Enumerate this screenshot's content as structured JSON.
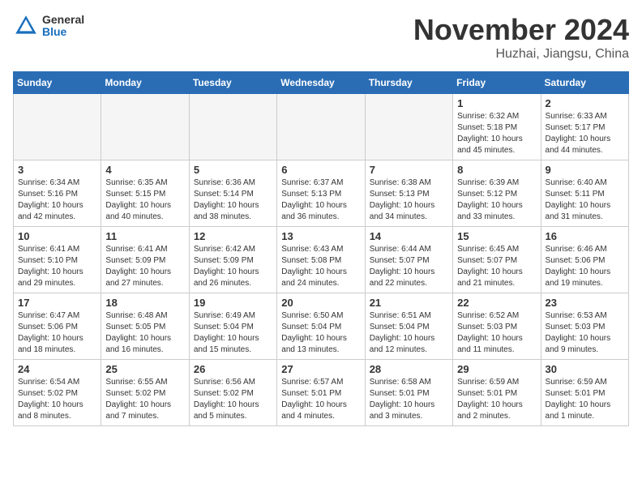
{
  "logo": {
    "general": "General",
    "blue": "Blue"
  },
  "title": "November 2024",
  "location": "Huzhai, Jiangsu, China",
  "weekdays": [
    "Sunday",
    "Monday",
    "Tuesday",
    "Wednesday",
    "Thursday",
    "Friday",
    "Saturday"
  ],
  "weeks": [
    [
      {
        "day": "",
        "info": ""
      },
      {
        "day": "",
        "info": ""
      },
      {
        "day": "",
        "info": ""
      },
      {
        "day": "",
        "info": ""
      },
      {
        "day": "",
        "info": ""
      },
      {
        "day": "1",
        "info": "Sunrise: 6:32 AM\nSunset: 5:18 PM\nDaylight: 10 hours\nand 45 minutes."
      },
      {
        "day": "2",
        "info": "Sunrise: 6:33 AM\nSunset: 5:17 PM\nDaylight: 10 hours\nand 44 minutes."
      }
    ],
    [
      {
        "day": "3",
        "info": "Sunrise: 6:34 AM\nSunset: 5:16 PM\nDaylight: 10 hours\nand 42 minutes."
      },
      {
        "day": "4",
        "info": "Sunrise: 6:35 AM\nSunset: 5:15 PM\nDaylight: 10 hours\nand 40 minutes."
      },
      {
        "day": "5",
        "info": "Sunrise: 6:36 AM\nSunset: 5:14 PM\nDaylight: 10 hours\nand 38 minutes."
      },
      {
        "day": "6",
        "info": "Sunrise: 6:37 AM\nSunset: 5:13 PM\nDaylight: 10 hours\nand 36 minutes."
      },
      {
        "day": "7",
        "info": "Sunrise: 6:38 AM\nSunset: 5:13 PM\nDaylight: 10 hours\nand 34 minutes."
      },
      {
        "day": "8",
        "info": "Sunrise: 6:39 AM\nSunset: 5:12 PM\nDaylight: 10 hours\nand 33 minutes."
      },
      {
        "day": "9",
        "info": "Sunrise: 6:40 AM\nSunset: 5:11 PM\nDaylight: 10 hours\nand 31 minutes."
      }
    ],
    [
      {
        "day": "10",
        "info": "Sunrise: 6:41 AM\nSunset: 5:10 PM\nDaylight: 10 hours\nand 29 minutes."
      },
      {
        "day": "11",
        "info": "Sunrise: 6:41 AM\nSunset: 5:09 PM\nDaylight: 10 hours\nand 27 minutes."
      },
      {
        "day": "12",
        "info": "Sunrise: 6:42 AM\nSunset: 5:09 PM\nDaylight: 10 hours\nand 26 minutes."
      },
      {
        "day": "13",
        "info": "Sunrise: 6:43 AM\nSunset: 5:08 PM\nDaylight: 10 hours\nand 24 minutes."
      },
      {
        "day": "14",
        "info": "Sunrise: 6:44 AM\nSunset: 5:07 PM\nDaylight: 10 hours\nand 22 minutes."
      },
      {
        "day": "15",
        "info": "Sunrise: 6:45 AM\nSunset: 5:07 PM\nDaylight: 10 hours\nand 21 minutes."
      },
      {
        "day": "16",
        "info": "Sunrise: 6:46 AM\nSunset: 5:06 PM\nDaylight: 10 hours\nand 19 minutes."
      }
    ],
    [
      {
        "day": "17",
        "info": "Sunrise: 6:47 AM\nSunset: 5:06 PM\nDaylight: 10 hours\nand 18 minutes."
      },
      {
        "day": "18",
        "info": "Sunrise: 6:48 AM\nSunset: 5:05 PM\nDaylight: 10 hours\nand 16 minutes."
      },
      {
        "day": "19",
        "info": "Sunrise: 6:49 AM\nSunset: 5:04 PM\nDaylight: 10 hours\nand 15 minutes."
      },
      {
        "day": "20",
        "info": "Sunrise: 6:50 AM\nSunset: 5:04 PM\nDaylight: 10 hours\nand 13 minutes."
      },
      {
        "day": "21",
        "info": "Sunrise: 6:51 AM\nSunset: 5:04 PM\nDaylight: 10 hours\nand 12 minutes."
      },
      {
        "day": "22",
        "info": "Sunrise: 6:52 AM\nSunset: 5:03 PM\nDaylight: 10 hours\nand 11 minutes."
      },
      {
        "day": "23",
        "info": "Sunrise: 6:53 AM\nSunset: 5:03 PM\nDaylight: 10 hours\nand 9 minutes."
      }
    ],
    [
      {
        "day": "24",
        "info": "Sunrise: 6:54 AM\nSunset: 5:02 PM\nDaylight: 10 hours\nand 8 minutes."
      },
      {
        "day": "25",
        "info": "Sunrise: 6:55 AM\nSunset: 5:02 PM\nDaylight: 10 hours\nand 7 minutes."
      },
      {
        "day": "26",
        "info": "Sunrise: 6:56 AM\nSunset: 5:02 PM\nDaylight: 10 hours\nand 5 minutes."
      },
      {
        "day": "27",
        "info": "Sunrise: 6:57 AM\nSunset: 5:01 PM\nDaylight: 10 hours\nand 4 minutes."
      },
      {
        "day": "28",
        "info": "Sunrise: 6:58 AM\nSunset: 5:01 PM\nDaylight: 10 hours\nand 3 minutes."
      },
      {
        "day": "29",
        "info": "Sunrise: 6:59 AM\nSunset: 5:01 PM\nDaylight: 10 hours\nand 2 minutes."
      },
      {
        "day": "30",
        "info": "Sunrise: 6:59 AM\nSunset: 5:01 PM\nDaylight: 10 hours\nand 1 minute."
      }
    ]
  ]
}
